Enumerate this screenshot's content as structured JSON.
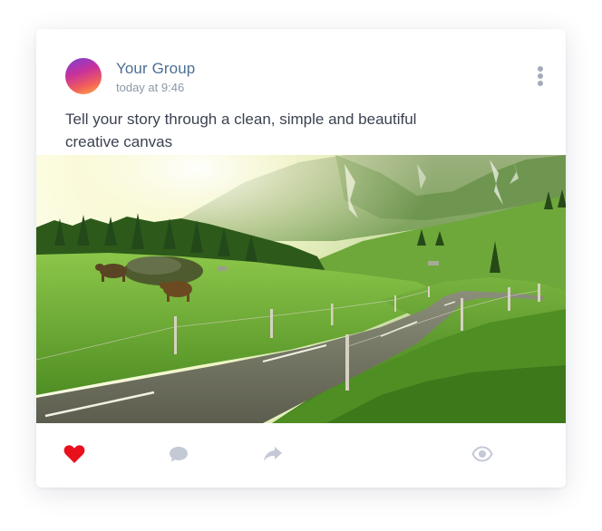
{
  "post": {
    "group_name": "Your Group",
    "timestamp": "today at 9:46",
    "text": "Tell your story through a clean, simple and beautiful creative canvas",
    "image_subject": "mountain valley road with grazing cows"
  },
  "actions": {
    "like_icon": "heart-icon",
    "comment_icon": "comment-icon",
    "share_icon": "share-icon",
    "views_icon": "eye-icon",
    "menu_icon": "more-vertical-icon"
  },
  "colors": {
    "group_name": "#4c6f95",
    "like_active": "#e8101d",
    "icon_muted": "#c4c9d6",
    "text": "#3b4250",
    "timestamp": "#8c97a6"
  }
}
